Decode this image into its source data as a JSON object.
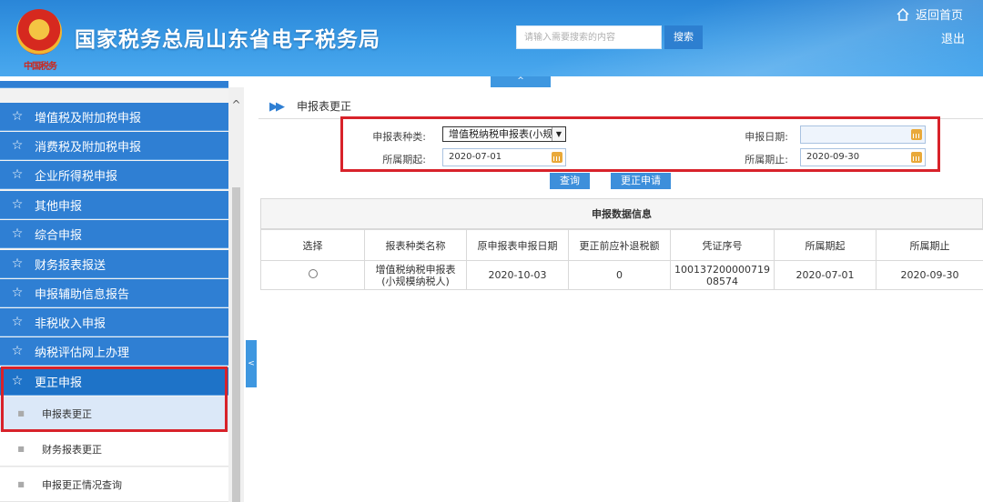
{
  "header": {
    "emblem_text": "中国税务",
    "site_title": "国家税务总局山东省电子税务局",
    "search_placeholder": "请输入需要搜索的内容",
    "search_button": "搜索",
    "home_link": "返回首页",
    "logout_link": "退出",
    "collapse_glyph": "^"
  },
  "sidebar": {
    "scroll_up_glyph": "^",
    "toggle_glyph": "<",
    "items": [
      {
        "label": "增值税及附加税申报"
      },
      {
        "label": "消费税及附加税申报"
      },
      {
        "label": "企业所得税申报"
      },
      {
        "label": "其他申报"
      },
      {
        "label": "综合申报"
      },
      {
        "label": "财务报表报送"
      },
      {
        "label": "申报辅助信息报告"
      },
      {
        "label": "非税收入申报"
      },
      {
        "label": "纳税评估网上办理"
      },
      {
        "label": "更正申报"
      }
    ],
    "sub_items": [
      {
        "label": "申报表更正"
      },
      {
        "label": "财务报表更正"
      },
      {
        "label": "申报更正情况查询"
      }
    ]
  },
  "main": {
    "breadcrumb": "申报表更正",
    "form": {
      "report_type_label": "申报表种类:",
      "report_type_value": "增值税纳税申报表(小规",
      "declare_date_label": "申报日期:",
      "declare_date_value": "",
      "period_start_label": "所属期起:",
      "period_start_value": "2020-07-01",
      "period_end_label": "所属期止:",
      "period_end_value": "2020-09-30",
      "query_button": "查询",
      "apply_button": "更正申请"
    },
    "table": {
      "caption": "申报数据信息",
      "headers": [
        "选择",
        "报表种类名称",
        "原申报表申报日期",
        "更正前应补退税额",
        "凭证序号",
        "所属期起",
        "所属期止"
      ],
      "rows": [
        {
          "name": "增值税纳税申报表(小规模纳税人)",
          "orig_date": "2020-10-03",
          "amount": "0",
          "voucher": "10013720000071908574",
          "period_start": "2020-07-01",
          "period_end": "2020-09-30"
        }
      ]
    }
  },
  "colors": {
    "header_blue": "#3a9be6",
    "nav_blue": "#2f7fd3",
    "highlight_red": "#d8222a",
    "button_blue": "#3d8fdb"
  }
}
